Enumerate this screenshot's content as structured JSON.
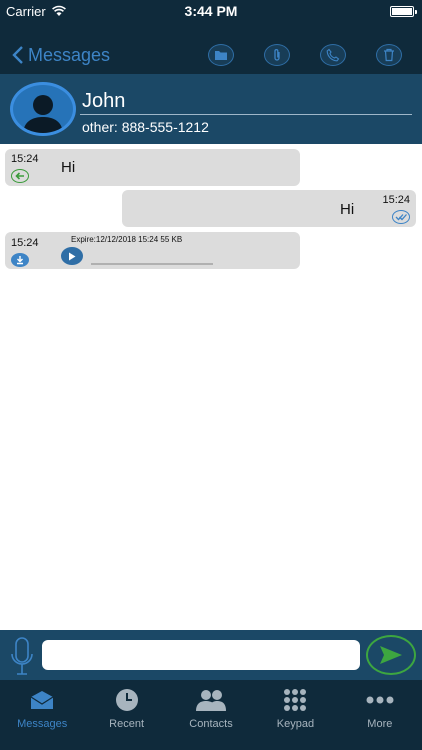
{
  "status": {
    "carrier": "Carrier",
    "time": "3:44 PM"
  },
  "nav": {
    "back_label": "Messages",
    "icons": [
      "folder-icon",
      "paperclip-icon",
      "phone-icon",
      "trash-icon"
    ]
  },
  "contact": {
    "name": "John",
    "phone": "other: 888-555-1212"
  },
  "messages": [
    {
      "direction": "incoming",
      "time": "15:24",
      "text": "Hi",
      "status_icon": "reply-arrow-icon"
    },
    {
      "direction": "outgoing",
      "time": "15:24",
      "text": "Hi",
      "status_icon": "double-check-icon"
    },
    {
      "direction": "incoming",
      "time": "15:24",
      "type": "audio",
      "info": "Expire:12/12/2018 15:24 55 KB",
      "status_icon": "download-icon"
    }
  ],
  "composer": {
    "placeholder": "",
    "value": ""
  },
  "tabs": [
    {
      "label": "Messages",
      "icon": "envelope-icon",
      "active": true
    },
    {
      "label": "Recent",
      "icon": "clock-icon",
      "active": false
    },
    {
      "label": "Contacts",
      "icon": "contacts-icon",
      "active": false
    },
    {
      "label": "Keypad",
      "icon": "keypad-icon",
      "active": false
    },
    {
      "label": "More",
      "icon": "more-icon",
      "active": false
    }
  ],
  "colors": {
    "nav_bg": "#0f2a3b",
    "header_bg": "#1b4866",
    "accent": "#3d84c6",
    "bubble": "#dcdcdc",
    "send": "#3da640"
  }
}
